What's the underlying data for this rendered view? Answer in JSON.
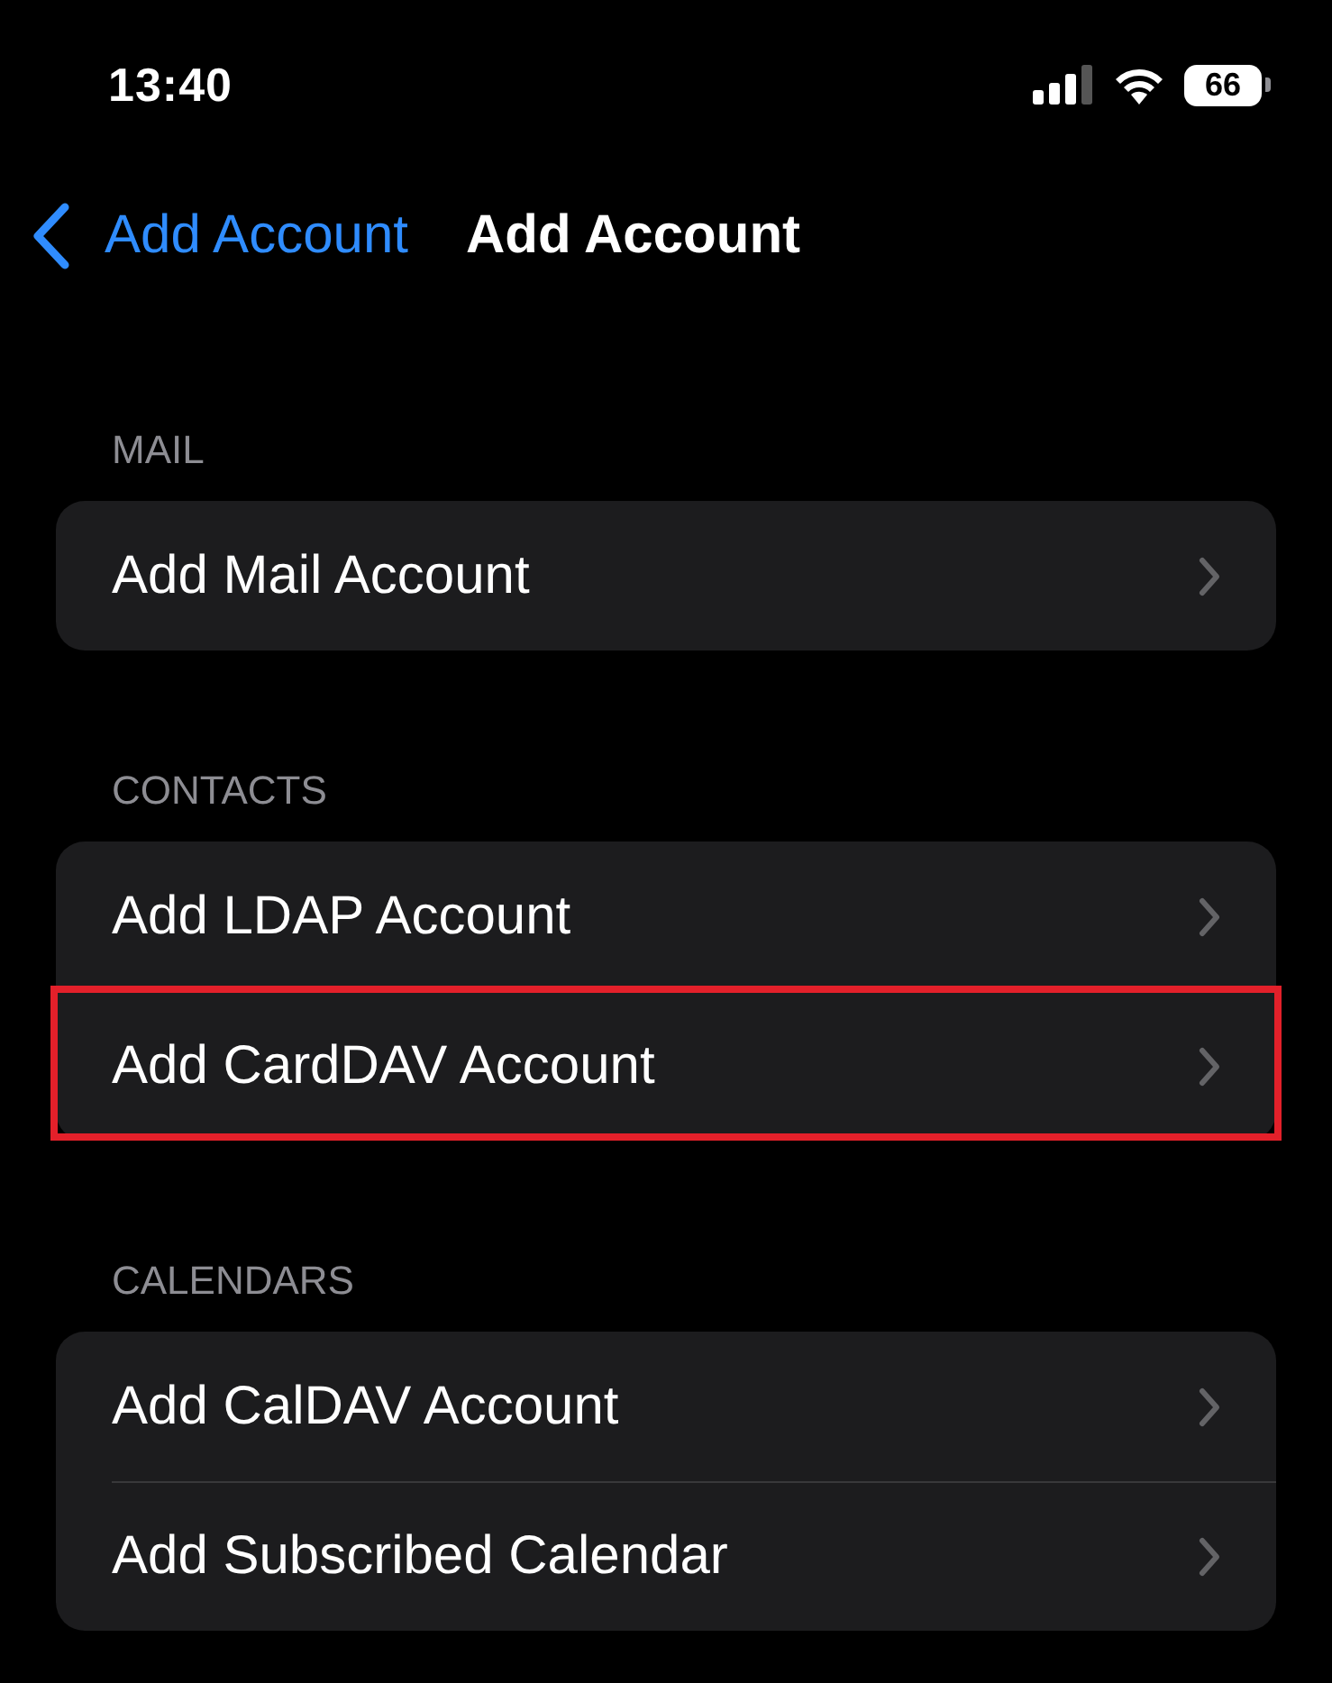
{
  "status_bar": {
    "time": "13:40",
    "battery": "66"
  },
  "nav": {
    "back_label": "Add Account",
    "title": "Add Account"
  },
  "sections": [
    {
      "header": "MAIL",
      "rows": [
        {
          "label": "Add Mail Account",
          "highlighted": false
        }
      ]
    },
    {
      "header": "CONTACTS",
      "rows": [
        {
          "label": "Add LDAP Account",
          "highlighted": false
        },
        {
          "label": "Add CardDAV Account",
          "highlighted": true
        }
      ]
    },
    {
      "header": "CALENDARS",
      "rows": [
        {
          "label": "Add CalDAV Account",
          "highlighted": false
        },
        {
          "label": "Add Subscribed Calendar",
          "highlighted": false
        }
      ]
    }
  ]
}
